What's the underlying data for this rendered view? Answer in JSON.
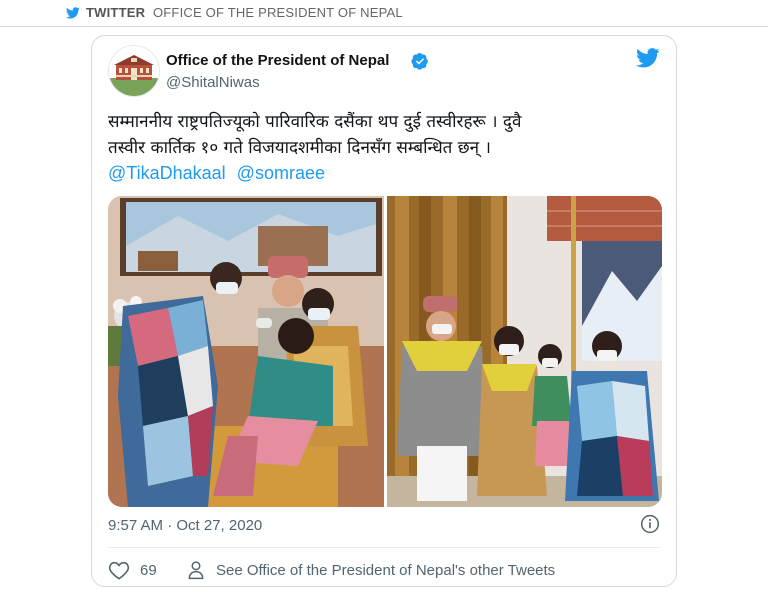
{
  "header": {
    "source_label": "TWITTER",
    "account_label": "OFFICE OF THE PRESIDENT OF NEPAL"
  },
  "tweet": {
    "display_name": "Office of the President of Nepal",
    "handle": "@ShitalNiwas",
    "text_line1": "सम्माननीय राष्ट्रपतिज्यूको पारिवारिक दसैंका थप दुई तस्वीरहरू । दुवै",
    "text_line2": "तस्वीर कार्तिक १० गते विजयादशमीका दिनसँग सम्बन्धित छन् ।",
    "mentions": [
      "@TikaDhakaal",
      "@somraee"
    ],
    "timestamp": "9:57 AM · Oct 27, 2020",
    "likes": "69",
    "see_more": "See Office of the President of Nepal's other Tweets"
  },
  "colors": {
    "twitter_blue": "#1d9bf0",
    "secondary_text": "#536471",
    "border": "#cfd9de"
  },
  "icons": {
    "bird": "twitter-bird-icon",
    "verified": "verified-badge-icon",
    "info": "info-icon",
    "heart": "heart-icon",
    "person": "person-icon"
  }
}
